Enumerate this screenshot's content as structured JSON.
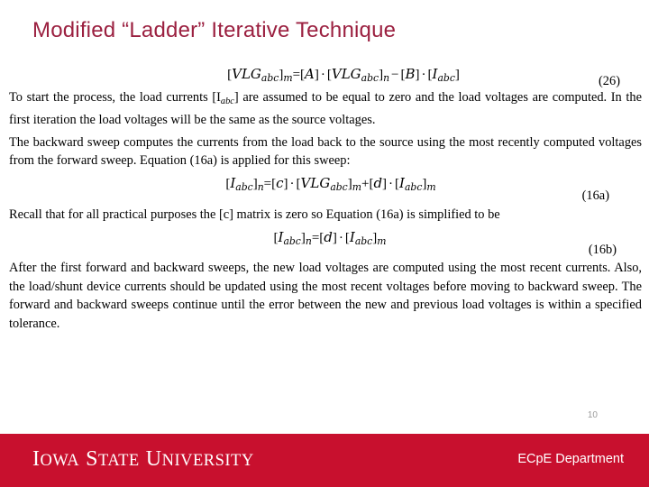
{
  "slide": {
    "title": "Modified “Ladder” Iterative Technique",
    "page_number": "10",
    "title_color": "#9B2040",
    "footer_color": "#C8102E"
  },
  "equations": {
    "eq26": {
      "number": "(26)",
      "lhs_bracket_open": "[",
      "lhs_var": "VLG",
      "lhs_sub": "abc",
      "lhs_bracket_close": "]",
      "lhs_index": "m",
      "equals": "=",
      "t1_open": "[",
      "t1_var": "A",
      "t1_close": "]",
      "dot1": "·",
      "t2_open": "[",
      "t2_var": "VLG",
      "t2_sub": "abc",
      "t2_close": "]",
      "t2_index": "n",
      "minus": "−",
      "t3_open": "[",
      "t3_var": "B",
      "t3_close": "]",
      "dot2": "·",
      "t4_open": "[",
      "t4_var": "I",
      "t4_sub": "abc",
      "t4_close": "]"
    },
    "eq16a": {
      "number": "(16a)",
      "lhs_open": "[",
      "lhs_var": "I",
      "lhs_sub": "abc",
      "lhs_close": "]",
      "lhs_index": "n",
      "equals": "=",
      "t1_open": "[",
      "t1_var": "c",
      "t1_close": "]",
      "dot1": "·",
      "t2_open": "[",
      "t2_var": "VLG",
      "t2_sub": "abc",
      "t2_close": "]",
      "t2_index": "m",
      "plus": "+",
      "t3_open": "[",
      "t3_var": "d",
      "t3_close": "]",
      "dot2": "·",
      "t4_open": "[",
      "t4_var": "I",
      "t4_sub": "abc",
      "t4_close": "]",
      "t4_index": "m"
    },
    "eq16b": {
      "number": "(16b)",
      "lhs_open": "[",
      "lhs_var": "I",
      "lhs_sub": "abc",
      "lhs_close": "]",
      "lhs_index": "n",
      "equals": "=",
      "t1_open": "[",
      "t1_var": "d",
      "t1_close": "]",
      "dot1": "·",
      "t2_open": "[",
      "t2_var": "I",
      "t2_sub": "abc",
      "t2_close": "]",
      "t2_index": "m"
    }
  },
  "paragraphs": {
    "p1_a": "To start the process, the load currents [",
    "p1_var": "I",
    "p1_sub": "abc",
    "p1_b": "] are assumed to be equal to zero and the load voltages are computed. In the first iteration the load voltages will be the same as the source voltages.",
    "p2": "The backward sweep computes the currents from the load back to the source using the most recently computed voltages from the forward sweep. Equation (16a) is applied for this sweep:",
    "p3_a": "Recall that for all practical purposes the [",
    "p3_var": "c",
    "p3_b": "] matrix is zero so Equation (16a) is simplified to be",
    "p4": "After the first forward and backward sweeps, the new load voltages are computed using the most recent currents. Also, the load/shunt device currents should be updated using the most recent voltages before moving to backward sweep. The forward and backward sweeps continue until the error between the new and previous load voltages is within a specified tolerance."
  },
  "footer": {
    "logo_i": "I",
    "logo_owa": "OWA",
    "logo_s": "S",
    "logo_tate": "TATE",
    "logo_u": "U",
    "logo_niversity": "NIVERSITY",
    "department": "ECpE Department"
  }
}
